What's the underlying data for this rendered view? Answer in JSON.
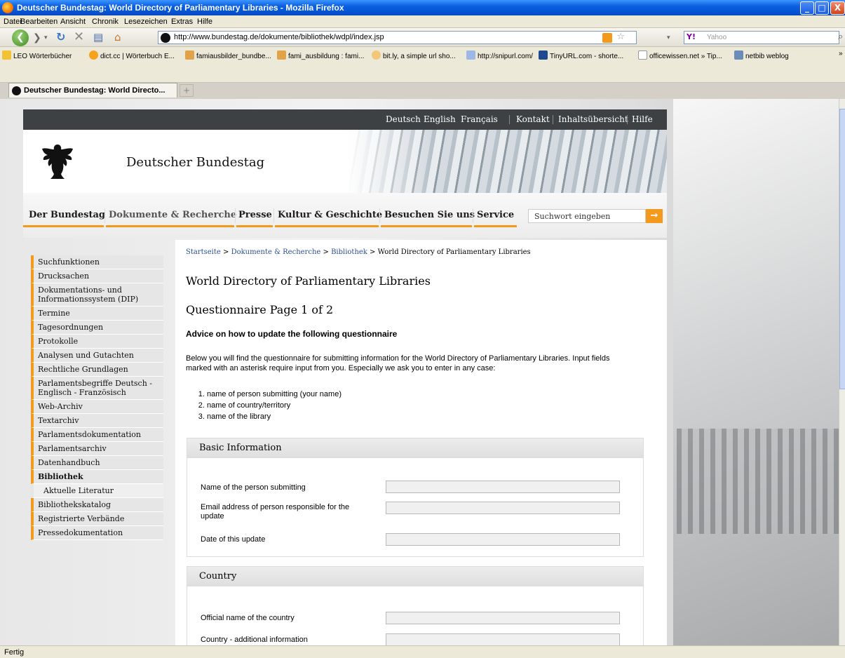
{
  "window": {
    "title": "Deutscher Bundestag: World Directory of Parliamentary Libraries - Mozilla Firefox",
    "min": "_",
    "max": "□",
    "close": "X"
  },
  "menu": [
    "Datei",
    "Bearbeiten",
    "Ansicht",
    "Chronik",
    "Lesezeichen",
    "Extras",
    "Hilfe"
  ],
  "toolbar": {
    "url": "http://www.bundestag.de/dokumente/bibliothek/wdpl/index.jsp",
    "search_placeholder": "Yahoo",
    "yahoo_label": "Y!"
  },
  "bookmarks": [
    "LEO Wörterbücher",
    "dict.cc | Wörterbuch E...",
    "famiausbilder_bundbe...",
    "fami_ausbildung : fami...",
    "bit.ly, a simple url sho...",
    "http://snipurl.com/",
    "TinyURL.com - shorte...",
    "officewissen.net » Tip...",
    "netbib weblog"
  ],
  "tab": {
    "label": "Deutscher Bundestag: World Directo..."
  },
  "site": {
    "lang": [
      "Deutsch",
      "English",
      "Français"
    ],
    "util": [
      "Kontakt",
      "Inhaltsübersicht",
      "Hilfe"
    ],
    "name": "Deutscher Bundestag",
    "nav": [
      "Der Bundestag",
      "Dokumente & Recherche",
      "Presse",
      "Kultur & Geschichte",
      "Besuchen Sie uns",
      "Service"
    ],
    "search_placeholder": "Suchwort eingeben",
    "accent": "#f39a1c"
  },
  "sidebar": [
    "Suchfunktionen",
    "Drucksachen",
    "Dokumentations- und Informationssystem (DIP)",
    "Termine",
    "Tagesordnungen",
    "Protokolle",
    "Analysen und Gutachten",
    "Rechtliche Grundlagen",
    "Parlamentsbegriffe Deutsch - Englisch - Französisch",
    "Web-Archiv",
    "Textarchiv",
    "Parlamentsdokumentation",
    "Parlamentsarchiv",
    "Datenhandbuch",
    "Bibliothek",
    "Aktuelle Literatur",
    "Bibliothekskatalog",
    "Registrierte Verbände",
    "Pressedokumentation"
  ],
  "breadcrumb": {
    "items": [
      "Startseite",
      "Dokumente & Recherche",
      "Bibliothek"
    ],
    "sep": " > ",
    "current": "World Directory of Parliamentary Libraries"
  },
  "main": {
    "title": "World Directory of Parliamentary Libraries",
    "subtitle": "Questionnaire Page 1 of 2",
    "advice_heading": "Advice on how to update the following questionnaire",
    "advice_text": "Below you will find the questionnaire for submitting information for the World Directory of Parliamentary Libraries. Input fields marked with an asterisk require input from you. Especially we ask you to enter in any case:",
    "advice_list": [
      "name of person submitting (your name)",
      "name of country/territory",
      "name of the library"
    ]
  },
  "basic": {
    "legend": "Basic Information",
    "fields": [
      "Name of the person submitting",
      "Email address of person responsible for the update",
      "Date of this update"
    ]
  },
  "country": {
    "legend": "Country",
    "fields": [
      "Official name of the country",
      "Country - additional information"
    ]
  },
  "status": "Fertig"
}
